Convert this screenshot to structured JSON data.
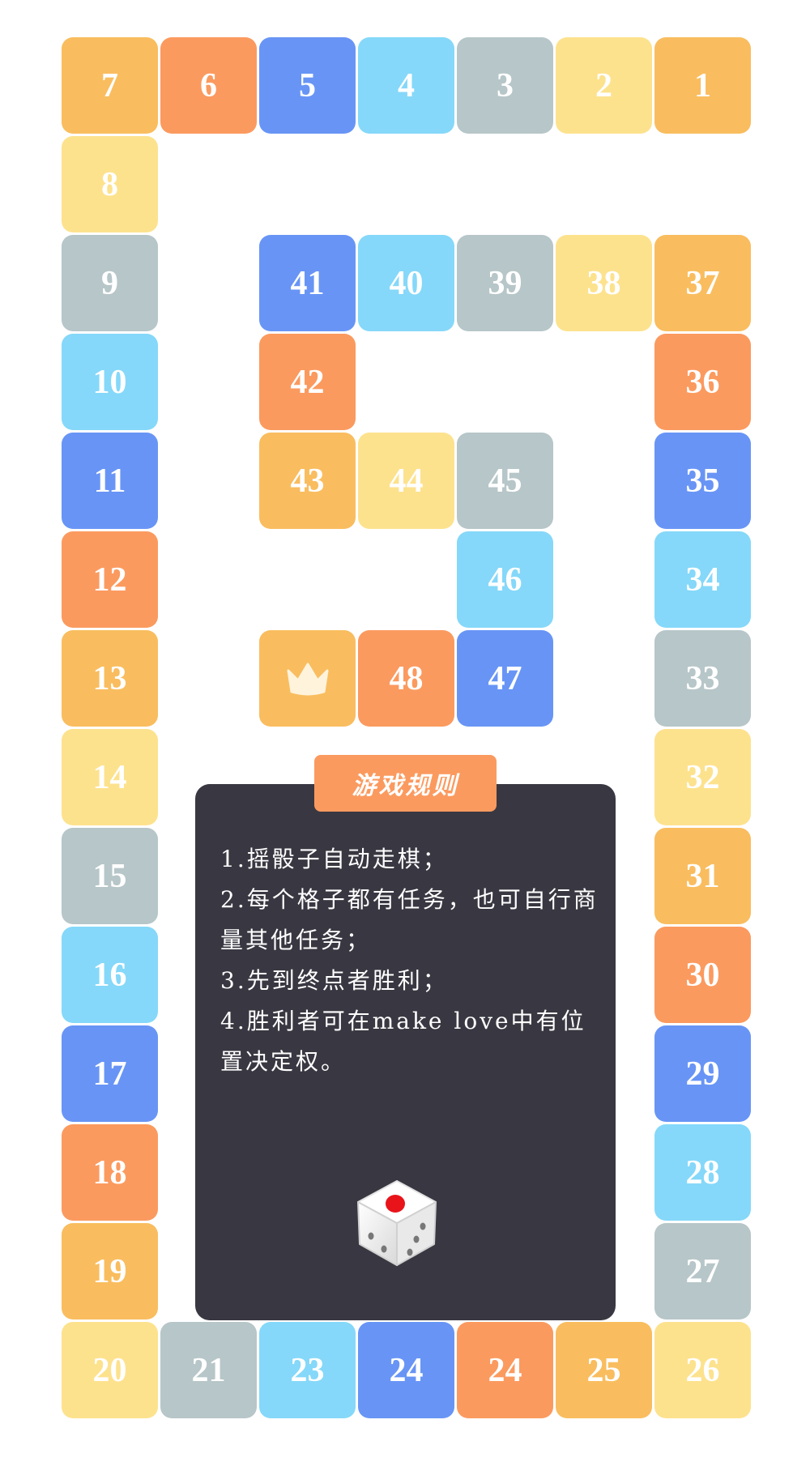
{
  "board": {
    "cells": [
      {
        "label": "1",
        "color": "#f9bd5f",
        "pos": [
          6,
          0
        ]
      },
      {
        "label": "2",
        "color": "#fde28e",
        "pos": [
          5,
          0
        ]
      },
      {
        "label": "3",
        "color": "#b7c6c8",
        "pos": [
          4,
          0
        ]
      },
      {
        "label": "4",
        "color": "#85d8f9",
        "pos": [
          3,
          0
        ]
      },
      {
        "label": "5",
        "color": "#6895f5",
        "pos": [
          2,
          0
        ]
      },
      {
        "label": "6",
        "color": "#fb9a5f",
        "pos": [
          1,
          0
        ]
      },
      {
        "label": "7",
        "color": "#f9bd5f",
        "pos": [
          0,
          0
        ]
      },
      {
        "label": "8",
        "color": "#fde28e",
        "pos": [
          0,
          1
        ]
      },
      {
        "label": "9",
        "color": "#b7c6c8",
        "pos": [
          0,
          2
        ]
      },
      {
        "label": "10",
        "color": "#85d8f9",
        "pos": [
          0,
          3
        ]
      },
      {
        "label": "11",
        "color": "#6895f5",
        "pos": [
          0,
          4
        ]
      },
      {
        "label": "12",
        "color": "#fb9a5f",
        "pos": [
          0,
          5
        ]
      },
      {
        "label": "13",
        "color": "#f9bd5f",
        "pos": [
          0,
          6
        ]
      },
      {
        "label": "14",
        "color": "#fde28e",
        "pos": [
          0,
          7
        ]
      },
      {
        "label": "15",
        "color": "#b7c6c8",
        "pos": [
          0,
          8
        ]
      },
      {
        "label": "16",
        "color": "#85d8f9",
        "pos": [
          0,
          9
        ]
      },
      {
        "label": "17",
        "color": "#6895f5",
        "pos": [
          0,
          10
        ]
      },
      {
        "label": "18",
        "color": "#fb9a5f",
        "pos": [
          0,
          11
        ]
      },
      {
        "label": "19",
        "color": "#f9bd5f",
        "pos": [
          0,
          12
        ]
      },
      {
        "label": "20",
        "color": "#fde28e",
        "pos": [
          0,
          13
        ]
      },
      {
        "label": "21",
        "color": "#b7c6c8",
        "pos": [
          1,
          13
        ]
      },
      {
        "label": "23",
        "color": "#85d8f9",
        "pos": [
          2,
          13
        ]
      },
      {
        "label": "24",
        "color": "#6895f5",
        "pos": [
          3,
          13
        ]
      },
      {
        "label": "24",
        "color": "#fb9a5f",
        "pos": [
          4,
          13
        ]
      },
      {
        "label": "25",
        "color": "#f9bd5f",
        "pos": [
          5,
          13
        ]
      },
      {
        "label": "26",
        "color": "#fde28e",
        "pos": [
          6,
          13
        ]
      },
      {
        "label": "27",
        "color": "#b7c6c8",
        "pos": [
          6,
          12
        ]
      },
      {
        "label": "28",
        "color": "#85d8f9",
        "pos": [
          6,
          11
        ]
      },
      {
        "label": "29",
        "color": "#6895f5",
        "pos": [
          6,
          10
        ]
      },
      {
        "label": "30",
        "color": "#fb9a5f",
        "pos": [
          6,
          9
        ]
      },
      {
        "label": "31",
        "color": "#f9bd5f",
        "pos": [
          6,
          8
        ]
      },
      {
        "label": "32",
        "color": "#fde28e",
        "pos": [
          6,
          7
        ]
      },
      {
        "label": "33",
        "color": "#b7c6c8",
        "pos": [
          6,
          6
        ]
      },
      {
        "label": "34",
        "color": "#85d8f9",
        "pos": [
          6,
          5
        ]
      },
      {
        "label": "35",
        "color": "#6895f5",
        "pos": [
          6,
          4
        ]
      },
      {
        "label": "36",
        "color": "#fb9a5f",
        "pos": [
          6,
          3
        ]
      },
      {
        "label": "37",
        "color": "#f9bd5f",
        "pos": [
          6,
          2
        ]
      },
      {
        "label": "38",
        "color": "#fde28e",
        "pos": [
          5,
          2
        ]
      },
      {
        "label": "39",
        "color": "#b7c6c8",
        "pos": [
          4,
          2
        ]
      },
      {
        "label": "40",
        "color": "#85d8f9",
        "pos": [
          3,
          2
        ]
      },
      {
        "label": "41",
        "color": "#6895f5",
        "pos": [
          2,
          2
        ]
      },
      {
        "label": "42",
        "color": "#fb9a5f",
        "pos": [
          2,
          3
        ]
      },
      {
        "label": "43",
        "color": "#f9bd5f",
        "pos": [
          2,
          4
        ]
      },
      {
        "label": "44",
        "color": "#fde28e",
        "pos": [
          3,
          4
        ]
      },
      {
        "label": "45",
        "color": "#b7c6c8",
        "pos": [
          4,
          4
        ]
      },
      {
        "label": "46",
        "color": "#85d8f9",
        "pos": [
          4,
          5
        ]
      },
      {
        "label": "47",
        "color": "#6895f5",
        "pos": [
          4,
          6
        ]
      },
      {
        "label": "48",
        "color": "#fb9a5f",
        "pos": [
          3,
          6
        ]
      },
      {
        "label": "",
        "icon": "crown-icon",
        "color": "#f9bd5f",
        "pos": [
          2,
          6
        ]
      }
    ]
  },
  "rules": {
    "title": "游戏规则",
    "items": [
      "1.摇骰子自动走棋；",
      "2.每个格子都有任务，也可自行商量其他任务；",
      "3.先到终点者胜利；",
      "4.胜利者可在make love中有位置决定权。"
    ],
    "dice_icon": "dice-icon"
  }
}
